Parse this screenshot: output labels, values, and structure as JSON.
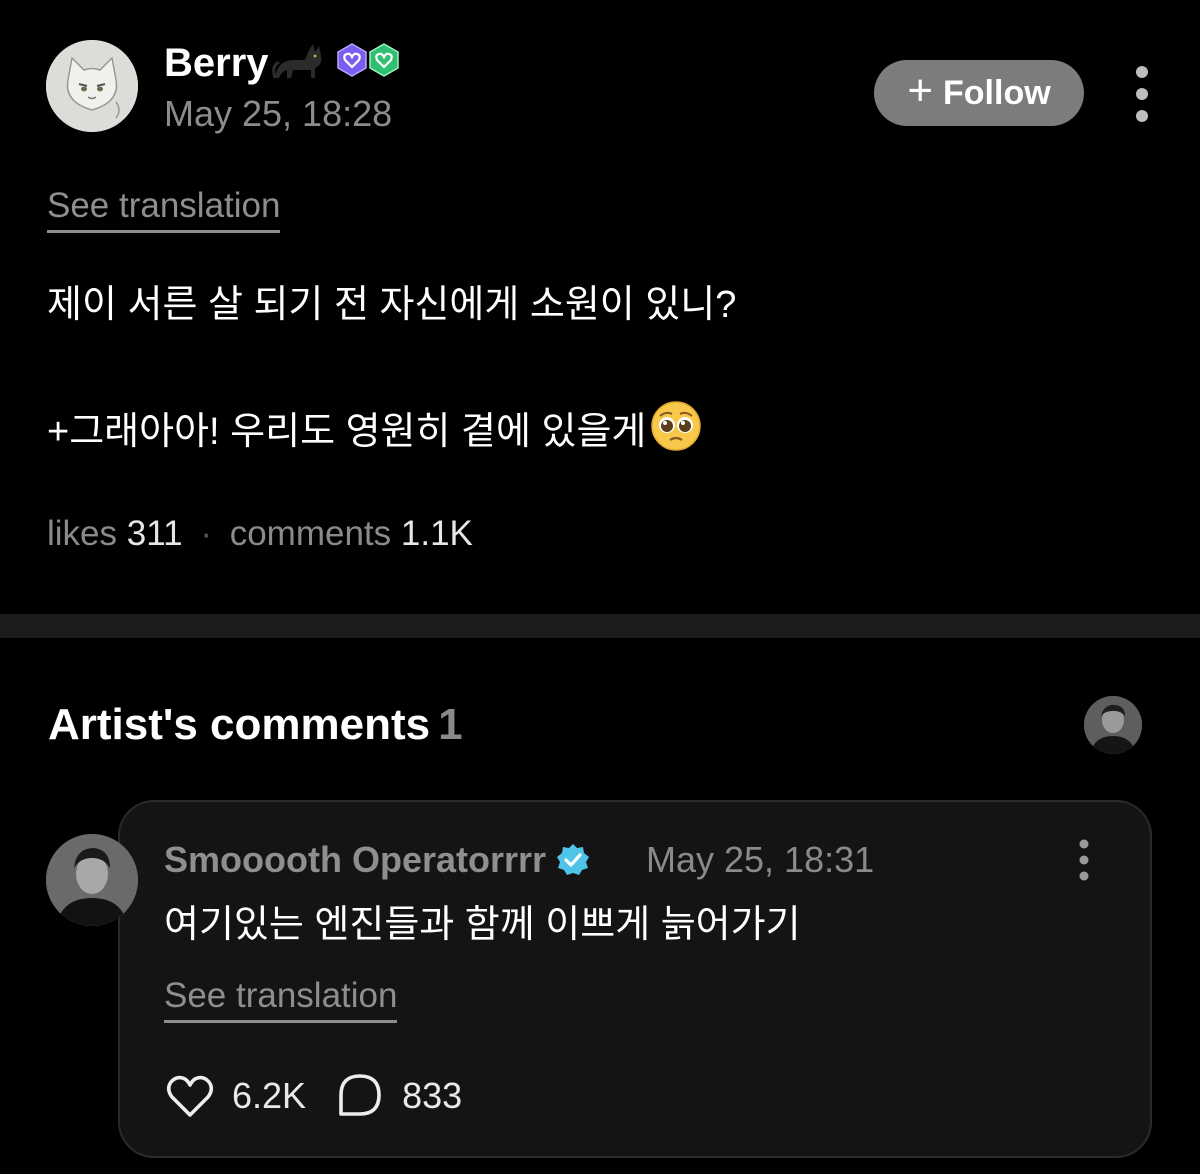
{
  "post": {
    "author": "Berry",
    "date": "May 25, 18:28",
    "follow_label": "Follow",
    "see_translation": "See translation",
    "body_line1": "제이 서른 살 되기 전 자신에게 소원이 있니?",
    "body_line2": "+그래아아! 우리도 영원히 곁에 있을게",
    "likes_label": "likes",
    "likes_value": "311",
    "stats_sep": "·",
    "comments_label": "comments",
    "comments_value": "1.1K"
  },
  "artist_comments": {
    "heading": "Artist's comments",
    "count": "1"
  },
  "comment": {
    "author": "Smooooth Operatorrrr",
    "date": "May 25, 18:31",
    "text": "여기있는 엔진들과 함께 이쁘게 늙어가기",
    "see_translation": "See translation",
    "likes": "6.2K",
    "replies": "833"
  },
  "icons": {
    "follow": "plus-icon",
    "more": "more-vertical-icon",
    "like": "heart-icon",
    "reply": "comment-bubble-icon",
    "verified": "verified-check-icon"
  },
  "colors": {
    "background": "#000000",
    "follow_button": "#7c7c7c",
    "verified": "#4fc3e8",
    "badge_purple": "#7b5cf0",
    "badge_green": "#2fbf71"
  }
}
